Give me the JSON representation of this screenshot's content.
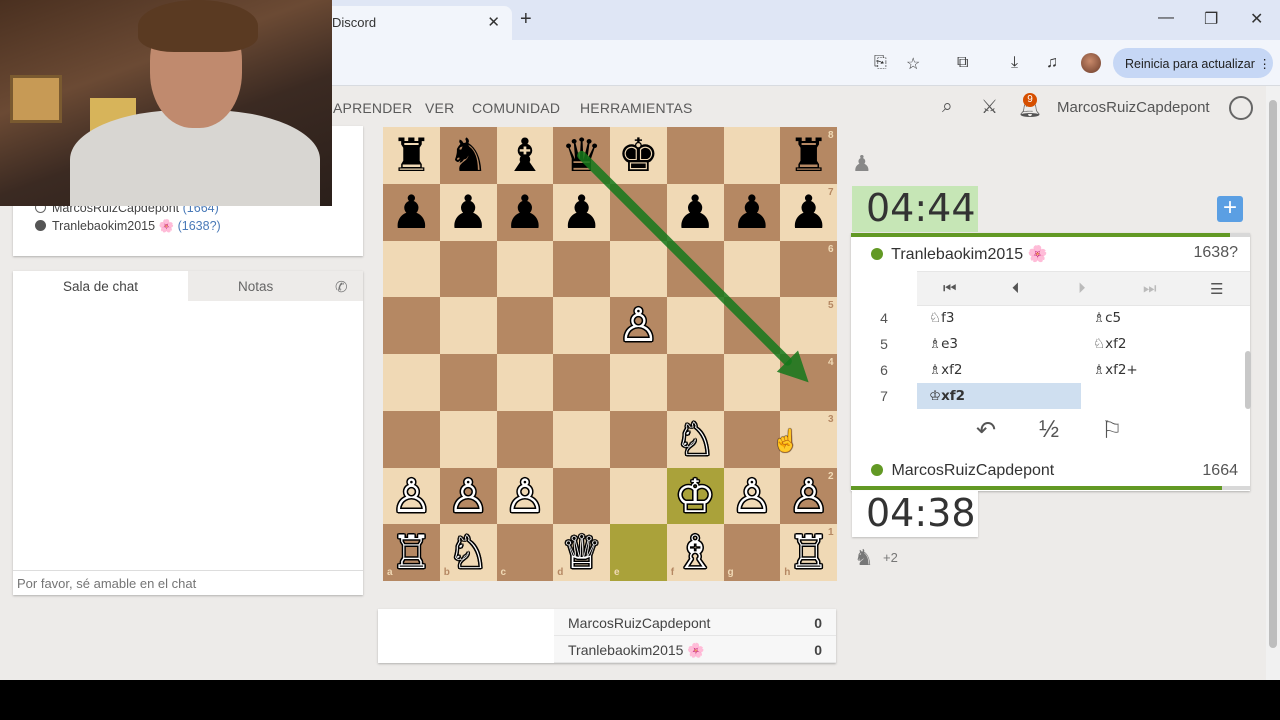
{
  "browser": {
    "tab_title": "Discord",
    "tab_close": "✕",
    "new_tab": "+",
    "window_controls": [
      "minimize",
      "maximize",
      "close"
    ],
    "toolbar_icons": [
      "install-app-icon",
      "bookmark-star-icon",
      "extensions-icon",
      "downloads-icon",
      "media-icon",
      "profile-avatar-icon"
    ],
    "update_button": "Reinicia para actualizar"
  },
  "site": {
    "nav": [
      "APRENDER",
      "VER",
      "COMUNIDAD",
      "HERRAMIENTAS"
    ],
    "top_icons": [
      "search-icon",
      "swords-icon",
      "bell-icon",
      "user-icon"
    ],
    "notifications_count": "9",
    "username": "MarcosRuizCapdepont",
    "colors": {
      "accent_green": "#629924",
      "clock_active": "#c6e6b6",
      "board_light": "#f0d9b5",
      "board_dark": "#b58863"
    }
  },
  "players_panel": {
    "players": [
      {
        "label": "MarcosRuizCapdepont",
        "rating": "(1664)",
        "online": false
      },
      {
        "label": "Tranlebaokim2015 🌸",
        "rating": "(1638?)",
        "online": true
      }
    ]
  },
  "chat": {
    "tab_chat": "Sala de chat",
    "tab_notes": "Notas",
    "input_placeholder": "Por favor, sé amable en el chat"
  },
  "board": {
    "files": [
      "a",
      "b",
      "c",
      "d",
      "e",
      "f",
      "g",
      "h"
    ],
    "ranks": [
      "8",
      "7",
      "6",
      "5",
      "4",
      "3",
      "2",
      "1"
    ],
    "highlight_squares": [
      "e1",
      "f2"
    ],
    "arrow": {
      "from": "d8",
      "to": "h4",
      "color": "#15781b"
    },
    "pieces": [
      {
        "sq": "a8",
        "g": "♜",
        "c": "b"
      },
      {
        "sq": "b8",
        "g": "♞",
        "c": "b"
      },
      {
        "sq": "c8",
        "g": "♝",
        "c": "b"
      },
      {
        "sq": "d8",
        "g": "♛",
        "c": "b"
      },
      {
        "sq": "e8",
        "g": "♚",
        "c": "b"
      },
      {
        "sq": "h8",
        "g": "♜",
        "c": "b"
      },
      {
        "sq": "a7",
        "g": "♟",
        "c": "b"
      },
      {
        "sq": "b7",
        "g": "♟",
        "c": "b"
      },
      {
        "sq": "c7",
        "g": "♟",
        "c": "b"
      },
      {
        "sq": "d7",
        "g": "♟",
        "c": "b"
      },
      {
        "sq": "f7",
        "g": "♟",
        "c": "b"
      },
      {
        "sq": "g7",
        "g": "♟",
        "c": "b"
      },
      {
        "sq": "h7",
        "g": "♟",
        "c": "b"
      },
      {
        "sq": "e5",
        "g": "♙",
        "c": "w"
      },
      {
        "sq": "f3",
        "g": "♘",
        "c": "w"
      },
      {
        "sq": "a2",
        "g": "♙",
        "c": "w"
      },
      {
        "sq": "b2",
        "g": "♙",
        "c": "w"
      },
      {
        "sq": "c2",
        "g": "♙",
        "c": "w"
      },
      {
        "sq": "f2",
        "g": "♔",
        "c": "w"
      },
      {
        "sq": "g2",
        "g": "♙",
        "c": "w"
      },
      {
        "sq": "h2",
        "g": "♙",
        "c": "w"
      },
      {
        "sq": "a1",
        "g": "♖",
        "c": "w"
      },
      {
        "sq": "b1",
        "g": "♘",
        "c": "w"
      },
      {
        "sq": "d1",
        "g": "♕",
        "c": "w"
      },
      {
        "sq": "f1",
        "g": "♗",
        "c": "w"
      },
      {
        "sq": "h1",
        "g": "♖",
        "c": "w"
      }
    ]
  },
  "scores": [
    {
      "name": "MarcosRuizCapdepont",
      "score": "0"
    },
    {
      "name": "Tranlebaokim2015 🌸",
      "score": "0"
    }
  ],
  "game": {
    "opponent": {
      "name": "Tranlebaokim2015 🌸",
      "rating": "1638?",
      "clock": "04:44",
      "bar_fraction": 0.95
    },
    "me": {
      "name": "MarcosRuizCapdepont",
      "rating": "1664",
      "clock": "04:38",
      "bar_fraction": 0.93
    },
    "moves": [
      {
        "no": "4",
        "white": "♘f3",
        "black": "♗c5"
      },
      {
        "no": "5",
        "white": "♗e3",
        "black": "♘xf2"
      },
      {
        "no": "6",
        "white": "♗xf2",
        "black": "♗xf2+"
      },
      {
        "no": "7",
        "white": "♔xf2",
        "black": ""
      }
    ],
    "active_move": "7w",
    "draw_symbol": "½",
    "captured_score": "+2"
  }
}
